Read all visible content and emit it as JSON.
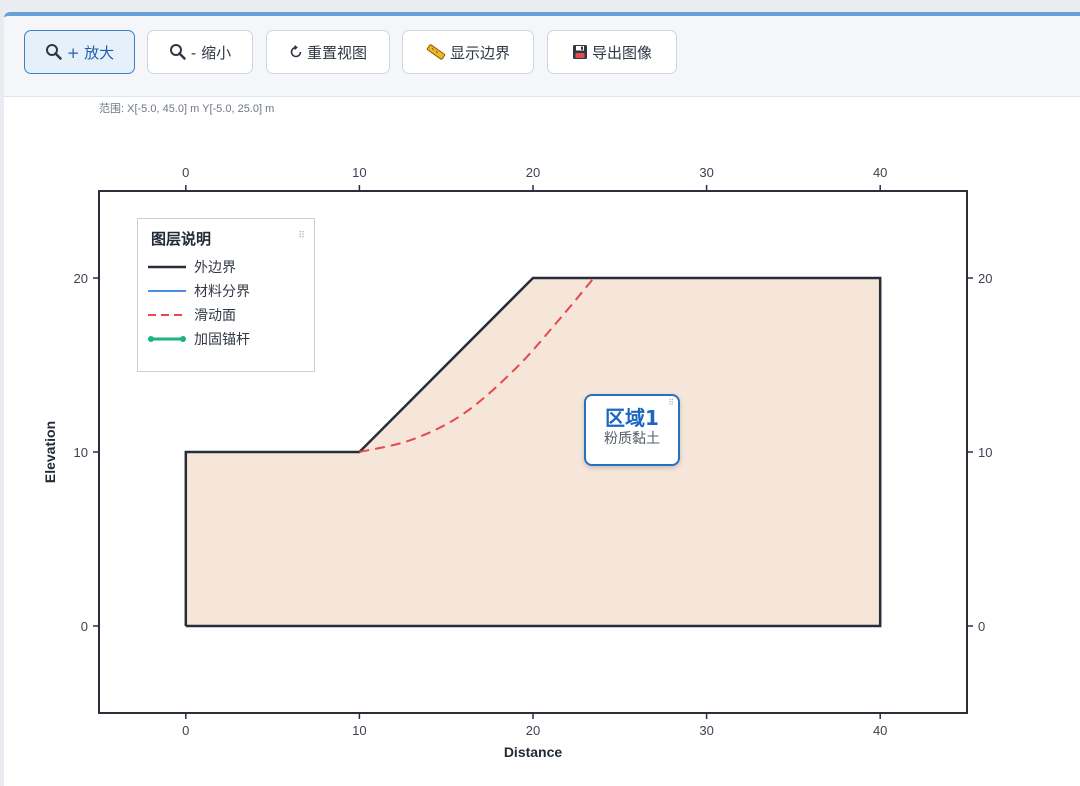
{
  "toolbar": {
    "zoom_in": "+ 放大",
    "zoom_out": "- 缩小",
    "reset_view": "重置视图",
    "show_boundary": "显示边界",
    "export_image": "导出图像"
  },
  "range_text": "范围: X[-5.0, 45.0] m  Y[-5.0, 25.0] m",
  "legend": {
    "title": "图层说明",
    "items": [
      {
        "label": "外边界",
        "color": "#272d3b",
        "style": "solid"
      },
      {
        "label": "材料分界",
        "color": "#4a90e2",
        "style": "solid"
      },
      {
        "label": "滑动面",
        "color": "#e5484d",
        "style": "dashed"
      },
      {
        "label": "加固锚杆",
        "color": "#1fb27a",
        "style": "dots"
      }
    ]
  },
  "region": {
    "name": "区域1",
    "material": "粉质黏土",
    "fill": "#f5e6d9",
    "border": "#2b6fc4"
  },
  "chart_data": {
    "type": "line",
    "xlabel": "Distance",
    "ylabel": "Elevation",
    "xlim": [
      -5,
      45
    ],
    "ylim": [
      -5,
      25
    ],
    "x_ticks": [
      0,
      10,
      20,
      30,
      40
    ],
    "y_ticks": [
      0,
      10,
      20
    ],
    "boundary": [
      [
        0,
        0
      ],
      [
        40,
        0
      ],
      [
        40,
        20
      ],
      [
        20,
        20
      ],
      [
        10,
        10
      ],
      [
        0,
        10
      ],
      [
        0,
        0
      ]
    ],
    "slip_surface": [
      [
        10,
        10
      ],
      [
        13,
        10.7
      ],
      [
        16,
        12.2
      ],
      [
        19,
        14.8
      ],
      [
        21.5,
        17.6
      ],
      [
        23.5,
        20
      ]
    ]
  }
}
